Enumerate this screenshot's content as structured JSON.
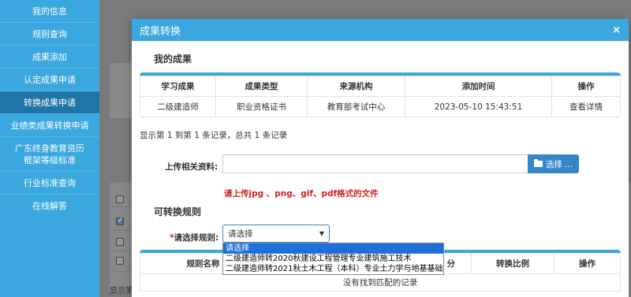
{
  "sidebar": {
    "items": [
      {
        "label": "我的信息"
      },
      {
        "label": "规则查询"
      },
      {
        "label": "成果添加"
      },
      {
        "label": "认定成果申请"
      },
      {
        "label": "转换成果申请"
      },
      {
        "label": "业绩类成果转换申请"
      },
      {
        "label": "广东终身教育资历框架等级标准"
      },
      {
        "label": "行业标准查询"
      },
      {
        "label": "在线解答"
      }
    ]
  },
  "background": {
    "footer_text": "显示第"
  },
  "modal": {
    "title": "成果转换",
    "close_icon": "×",
    "my_results": {
      "title": "我的成果",
      "headers": [
        "学习成果",
        "成果类型",
        "来源机构",
        "添加时间",
        "操作"
      ],
      "rows": [
        {
          "name": "二级建造师",
          "type": "职业资格证书",
          "source": "教育部考试中心",
          "time": "2023-05-10 15:43:51",
          "action": "查看详情"
        }
      ],
      "pager": "显示第 1 到第 1 条记录，总共 1 条记录"
    },
    "upload": {
      "label": "上传相关资料:",
      "value": "",
      "button_label": "选择 ...",
      "hint": "请上传jpg 、png、gif、pdf格式的文件"
    },
    "rules": {
      "title": "可转换规则",
      "required_mark": "*",
      "label": "请选择规则:",
      "selected": "请选择",
      "options": [
        "请选择",
        "二级建造师转2020秋建设工程管理专业建筑施工技术",
        "二级建造师转2021秋土木工程（本科）专业土力学与地基基础"
      ],
      "headers": [
        "规则名称",
        "",
        "",
        "分",
        "转换比例",
        "操作"
      ],
      "empty": "没有找到匹配的记录"
    }
  },
  "colors": {
    "sidebar_bg": "#3aa8de",
    "sidebar_active": "#1f74a8",
    "header_bg": "#3aa8de",
    "button_bg": "#3387c9",
    "hint_red": "#d32020",
    "option_selected": "#1e6fd9"
  }
}
